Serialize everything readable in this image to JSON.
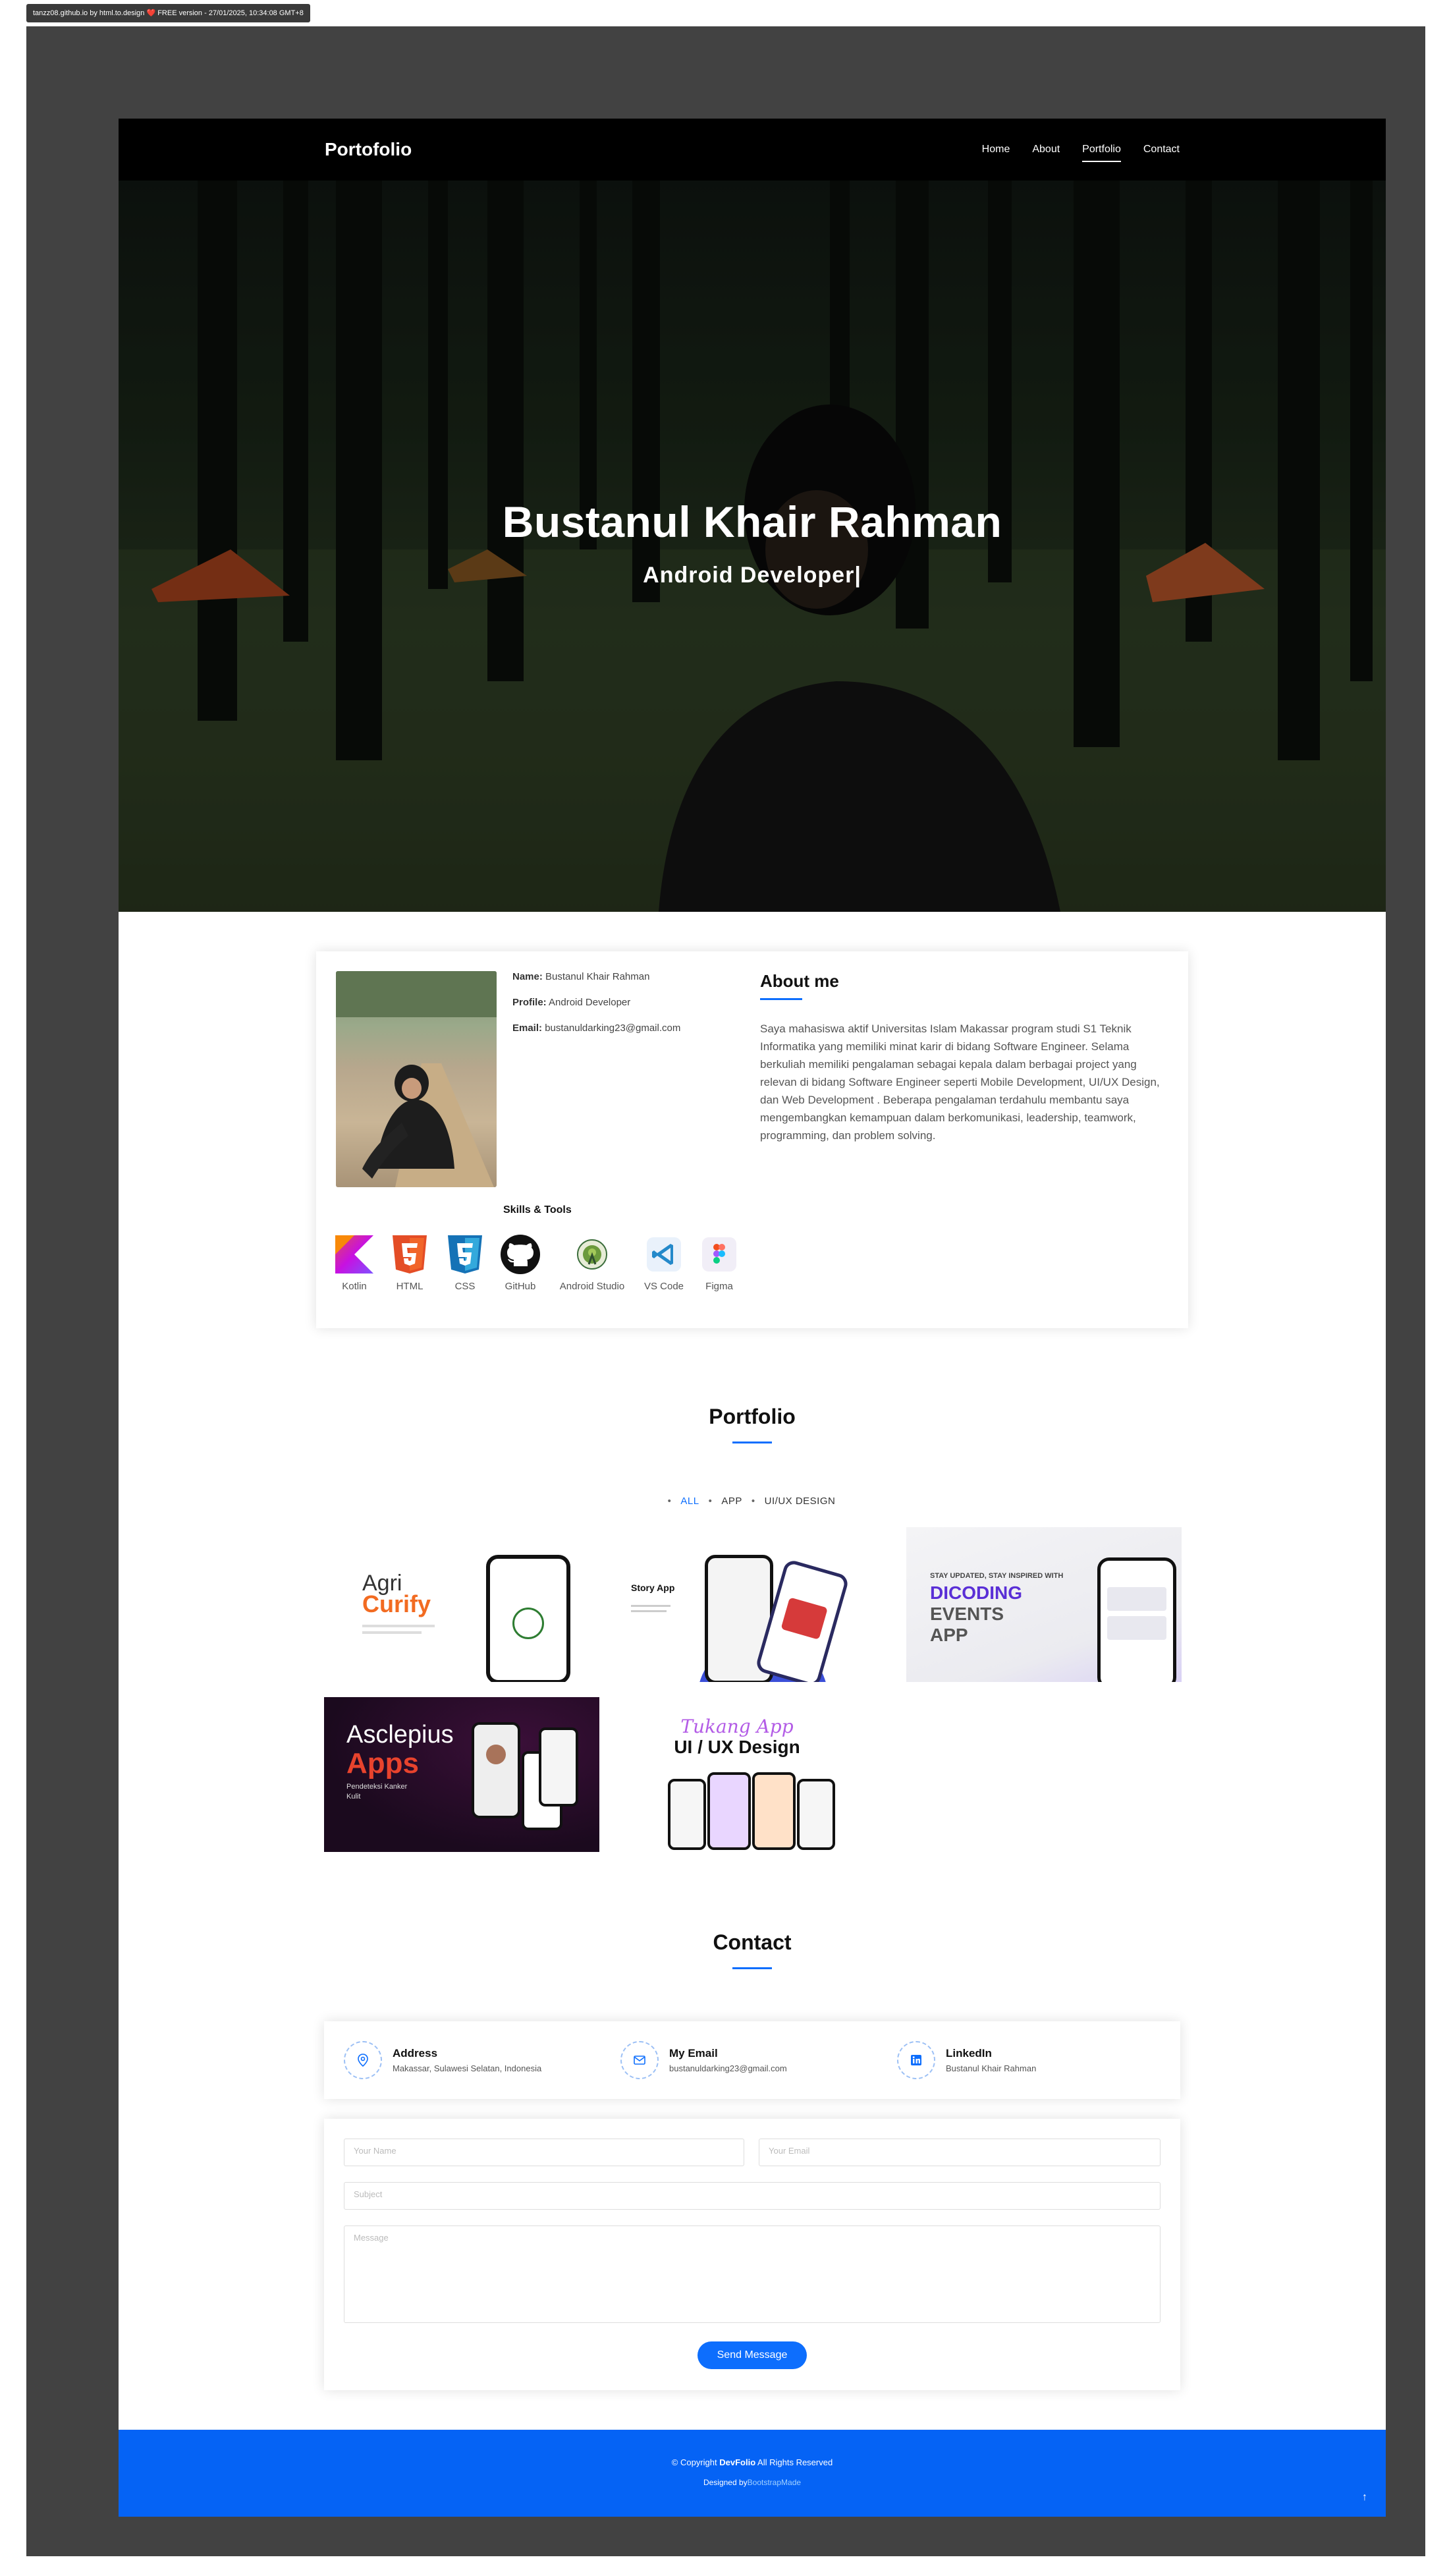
{
  "watermark": "tanzz08.github.io by html.to.design ❤️ FREE version - 27/01/2025, 10:34:08 GMT+8",
  "nav": {
    "brand": "Portofolio",
    "items": [
      "Home",
      "About",
      "Portfolio",
      "Contact"
    ],
    "active": "Portfolio"
  },
  "hero": {
    "title": "Bustanul Khair Rahman",
    "subtitle": "Android Developer|"
  },
  "about": {
    "name_label": "Name:",
    "name_value": "Bustanul Khair Rahman",
    "profile_label": "Profile:",
    "profile_value": "Android Developer",
    "email_label": "Email:",
    "email_value": "bustanuldarking23@gmail.com",
    "heading": "About me",
    "text": "Saya mahasiswa aktif Universitas Islam Makassar program studi S1 Teknik Informatika yang memiliki minat karir di bidang Software Engineer. Selama berkuliah memiliki pengalaman sebagai kepala dalam berbagai project yang relevan di bidang Software Engineer seperti Mobile Development, UI/UX Design, dan Web Development . Beberapa pengalaman terdahulu membantu saya mengembangkan kemampuan dalam berkomunikasi, leadership, teamwork, programming, dan problem solving.",
    "skills_title": "Skills & Tools",
    "skills": [
      {
        "name": "Kotlin",
        "icon": "kotlin-icon"
      },
      {
        "name": "HTML",
        "icon": "html5-icon"
      },
      {
        "name": "CSS",
        "icon": "css3-icon"
      },
      {
        "name": "GitHub",
        "icon": "github-icon"
      },
      {
        "name": "Android Studio",
        "icon": "android-studio-icon"
      },
      {
        "name": "VS Code",
        "icon": "vscode-icon"
      },
      {
        "name": "Figma",
        "icon": "figma-icon"
      }
    ]
  },
  "portfolio": {
    "title": "Portfolio",
    "filters": [
      "ALL",
      "APP",
      "UI/UX DESIGN"
    ],
    "active_filter": "ALL",
    "tiles": {
      "agri_1": "Agri",
      "agri_2": "Curify",
      "story_title": "Story App",
      "dicoding_small": "STAY UPDATED, STAY INSPIRED WITH",
      "dicoding_1": "DICODING",
      "dicoding_2": "EVENTS",
      "dicoding_3": "APP",
      "asclepius_1": "Asclepius",
      "asclepius_2": "Apps",
      "asclepius_small_1": "Pendeteksi Kanker",
      "asclepius_small_2": "Kulit",
      "uiux_script": "Tukang App",
      "uiux_title": "UI / UX Design"
    }
  },
  "contact": {
    "title": "Contact",
    "address_title": "Address",
    "address_value": "Makassar, Sulawesi Selatan, Indonesia",
    "email_title": "My Email",
    "email_value": "bustanuldarking23@gmail.com",
    "linkedin_title": "LinkedIn",
    "linkedin_value": "Bustanul Khair Rahman",
    "ph_name": "Your Name",
    "ph_email": "Your Email",
    "ph_subject": "Subject",
    "ph_message": "Message",
    "send_label": "Send Message"
  },
  "footer": {
    "copy_pre": "© Copyright",
    "copy_brand": "DevFolio",
    "copy_post": "All Rights Reserved",
    "designed_pre": "Designed by",
    "designed_link": "BootstrapMade",
    "totop_icon": "arrow-up-icon"
  },
  "colors": {
    "accent": "#0d6efd",
    "footer": "#0563f5",
    "frame": "#424242"
  }
}
